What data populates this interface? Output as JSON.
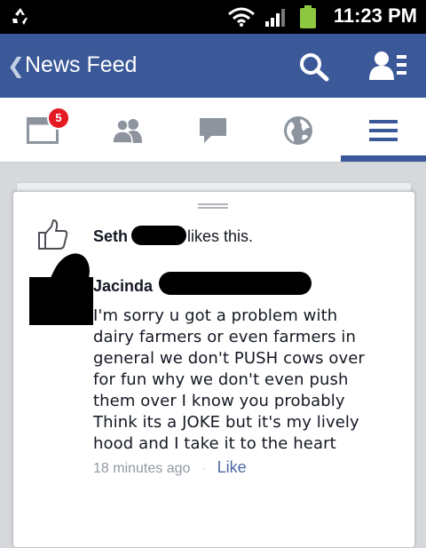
{
  "status_bar": {
    "time": "11:23 PM"
  },
  "header": {
    "back_label": "❮",
    "title": "News Feed"
  },
  "tabs": [
    {
      "name": "feed",
      "badge": "5"
    },
    {
      "name": "friend-requests"
    },
    {
      "name": "messages"
    },
    {
      "name": "notifications"
    },
    {
      "name": "more",
      "active": true
    }
  ],
  "likes": {
    "name": "Seth",
    "suffix": "likes this."
  },
  "comment": {
    "author": "Jacinda",
    "lines": [
      "I'm sorry u got a problem with",
      "dairy farmers or even farmers in",
      "general we don't PUSH cows over",
      "for fun why we don't even push",
      "them over I know you probably",
      "Think its a JOKE but it's my lively",
      "hood and I take it to the heart"
    ],
    "time": "18 minutes ago",
    "separator": "·",
    "like_label": "Like"
  },
  "colors": {
    "brand": "#3b5998",
    "badge": "#e41b23",
    "battery": "#8dc63f"
  }
}
